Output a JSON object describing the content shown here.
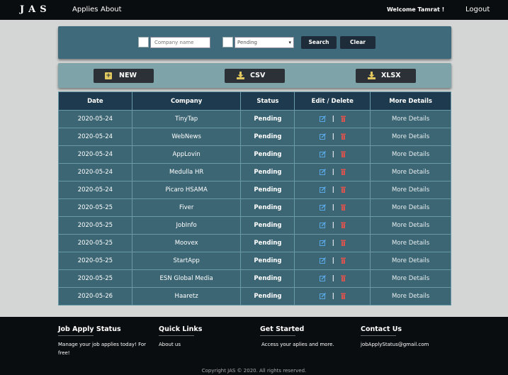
{
  "navbar": {
    "brand": "JAS",
    "links": [
      "Applies",
      "About"
    ],
    "welcome": "Welcome Tamrat !",
    "logout": "Logout"
  },
  "search": {
    "company_placeholder": "Company name",
    "status_selected": "Pending",
    "search_label": "Search",
    "clear_label": "Clear"
  },
  "actions": {
    "new_label": "NEW",
    "csv_label": "CSV",
    "xlsx_label": "XLSX"
  },
  "table": {
    "headers": [
      "Date",
      "Company",
      "Status",
      "Edit / Delete",
      "More Details"
    ],
    "separator": "|",
    "rows": [
      {
        "date": "2020-05-24",
        "company": "TinyTap",
        "status": "Pending",
        "more": "More Details"
      },
      {
        "date": "2020-05-24",
        "company": "WebNews",
        "status": "Pending",
        "more": "More Details"
      },
      {
        "date": "2020-05-24",
        "company": "AppLovin",
        "status": "Pending",
        "more": "More Details"
      },
      {
        "date": "2020-05-24",
        "company": "Medulla HR",
        "status": "Pending",
        "more": "More Details"
      },
      {
        "date": "2020-05-24",
        "company": "Picaro HSAMA",
        "status": "Pending",
        "more": "More Details"
      },
      {
        "date": "2020-05-25",
        "company": "Fiver",
        "status": "Pending",
        "more": "More Details"
      },
      {
        "date": "2020-05-25",
        "company": "JobInfo",
        "status": "Pending",
        "more": "More Details"
      },
      {
        "date": "2020-05-25",
        "company": "Moovex",
        "status": "Pending",
        "more": "More Details"
      },
      {
        "date": "2020-05-25",
        "company": "StartApp",
        "status": "Pending",
        "more": "More Details"
      },
      {
        "date": "2020-05-25",
        "company": "ESN Global Media",
        "status": "Pending",
        "more": "More Details"
      },
      {
        "date": "2020-05-26",
        "company": "Haaretz",
        "status": "Pending",
        "more": "More Details"
      }
    ]
  },
  "footer": {
    "col1": {
      "title": "Job Apply Status",
      "text": "Manage your job applies today! For free!"
    },
    "col2": {
      "title": "Quick Links",
      "text": "About us"
    },
    "col3": {
      "title": "Get Started",
      "text": "Access your aplies and more."
    },
    "col4": {
      "title": "Contact Us",
      "text": "jobApplyStatus@gmail.com"
    },
    "copyright": "Copyright JAS © 2020. All rights reserved."
  },
  "colors": {
    "navbar_bg": "#0a0d10",
    "search_panel_bg": "#3e6a7b",
    "action_panel_bg": "#7ea3a9",
    "table_header_bg": "#1d3a4e",
    "table_row_bg": "#3c6674",
    "delete_icon": "#d9534f",
    "edit_icon": "#5aa8e6",
    "accent_icon": "#e1c95f"
  },
  "icons": {
    "new": "plus-box-icon",
    "csv": "download-icon",
    "xlsx": "download-icon",
    "edit": "edit-icon",
    "delete": "trash-icon"
  }
}
